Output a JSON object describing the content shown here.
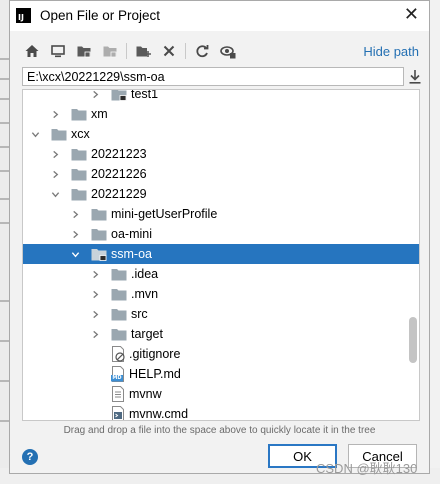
{
  "dialog": {
    "title": "Open File or Project",
    "app_badge": "IJ",
    "close_glyph": "✕"
  },
  "toolbar": {
    "buttons": [
      {
        "icon": "home-icon",
        "label": "Home"
      },
      {
        "icon": "desktop-icon",
        "label": "Desktop"
      },
      {
        "icon": "project-folder-icon",
        "label": "Project"
      },
      {
        "icon": "module-folder-icon",
        "label": "Module"
      },
      {
        "icon": "new-folder-icon",
        "label": "New Folder"
      },
      {
        "icon": "delete-icon",
        "label": "Delete"
      },
      {
        "icon": "refresh-icon",
        "label": "Refresh"
      },
      {
        "icon": "show-hidden-icon",
        "label": "Show Hidden"
      }
    ],
    "hide_path_label": "Hide path"
  },
  "path": {
    "value": "E:\\xcx\\20221229\\ssm-oa"
  },
  "tree": {
    "rows": [
      {
        "label": "test1",
        "kind": "folder-module",
        "expanded": false,
        "level": 4,
        "partial": true
      },
      {
        "label": "xm",
        "kind": "folder",
        "expanded": false,
        "level": 2
      },
      {
        "label": "xcx",
        "kind": "folder",
        "expanded": true,
        "level": 1
      },
      {
        "label": "20221223",
        "kind": "folder",
        "expanded": false,
        "level": 2
      },
      {
        "label": "20221226",
        "kind": "folder",
        "expanded": false,
        "level": 2
      },
      {
        "label": "20221229",
        "kind": "folder",
        "expanded": true,
        "level": 2
      },
      {
        "label": "mini-getUserProfile",
        "kind": "folder",
        "expanded": false,
        "level": 3
      },
      {
        "label": "oa-mini",
        "kind": "folder",
        "expanded": false,
        "level": 3
      },
      {
        "label": "ssm-oa",
        "kind": "folder-module",
        "expanded": true,
        "level": 3,
        "selected": true
      },
      {
        "label": ".idea",
        "kind": "folder",
        "expanded": false,
        "level": 4
      },
      {
        "label": ".mvn",
        "kind": "folder",
        "expanded": false,
        "level": 4
      },
      {
        "label": "src",
        "kind": "folder",
        "expanded": false,
        "level": 4
      },
      {
        "label": "target",
        "kind": "folder",
        "expanded": false,
        "level": 4
      },
      {
        "label": ".gitignore",
        "kind": "file-ignore",
        "level": 4
      },
      {
        "label": "HELP.md",
        "kind": "file-md",
        "level": 4
      },
      {
        "label": "mvnw",
        "kind": "file-text",
        "level": 4
      },
      {
        "label": "mvnw.cmd",
        "kind": "file-cmd",
        "level": 4
      }
    ],
    "md_badge": "MD"
  },
  "hint": "Drag and drop a file into the space above to quickly locate it in the tree",
  "footer": {
    "help_glyph": "?",
    "ok_label": "OK",
    "cancel_label": "Cancel",
    "watermark": "CSDN @耿耿130"
  },
  "colors": {
    "accent": "#2470b3",
    "selection": "#2675bf",
    "folder": "#9aa7b0"
  }
}
